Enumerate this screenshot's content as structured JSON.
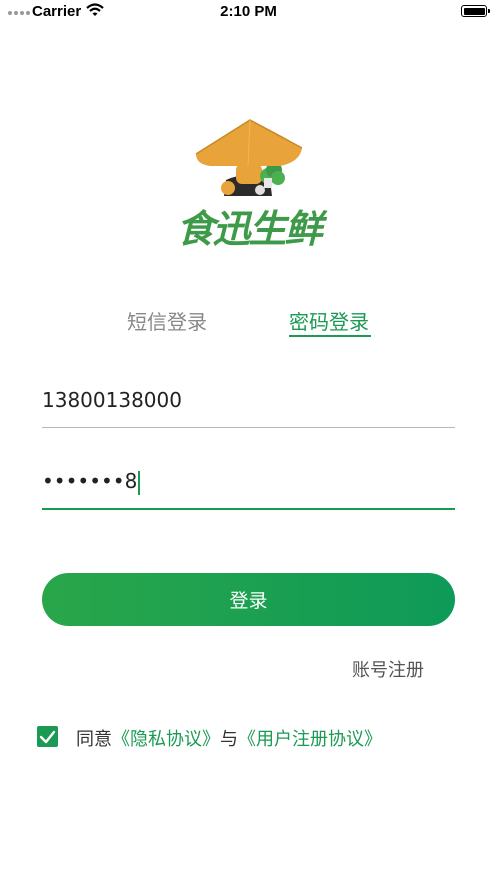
{
  "status_bar": {
    "carrier": "Carrier",
    "time": "2:10 PM"
  },
  "brand": {
    "name": "食迅生鲜"
  },
  "tabs": [
    {
      "label": "短信登录",
      "active": false
    },
    {
      "label": "密码登录",
      "active": true
    }
  ],
  "form": {
    "phone_value": "13800138000",
    "password_value": "•••••••8"
  },
  "login_button": "登录",
  "register_link": "账号注册",
  "agreement": {
    "checked": true,
    "prefix": "同意",
    "privacy_link": "《隐私协议》",
    "joiner": "与",
    "user_link": "《用户注册协议》"
  },
  "colors": {
    "accent": "#1a9a52",
    "hat": "#e8a33a"
  }
}
